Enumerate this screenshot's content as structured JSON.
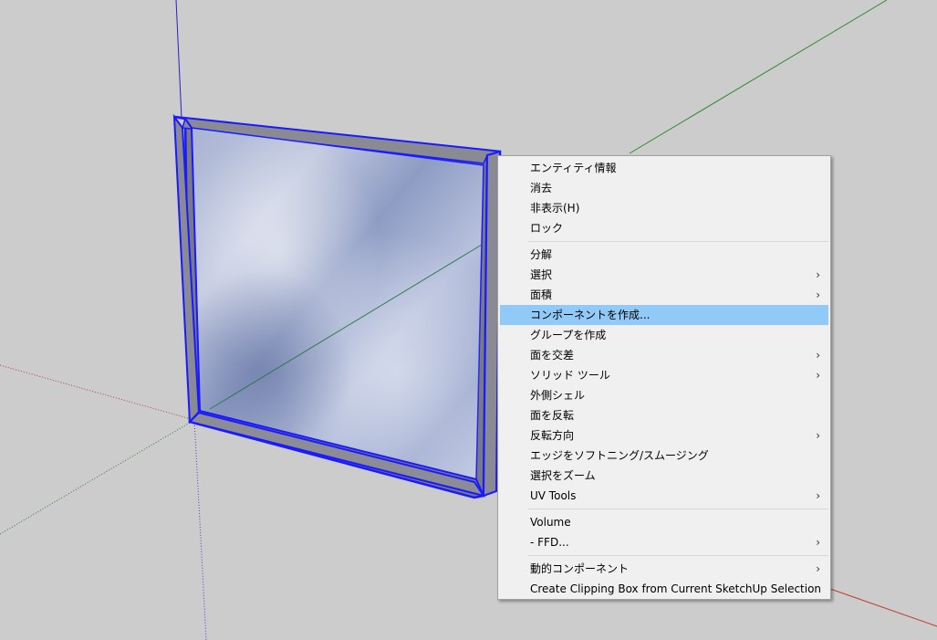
{
  "context_menu": {
    "groups": [
      [
        {
          "label": "エンティティ情報",
          "submenu": false
        },
        {
          "label": "消去",
          "submenu": false
        },
        {
          "label": "非表示(H)",
          "submenu": false
        },
        {
          "label": "ロック",
          "submenu": false
        }
      ],
      [
        {
          "label": "分解",
          "submenu": false
        },
        {
          "label": "選択",
          "submenu": true
        },
        {
          "label": "面積",
          "submenu": true
        },
        {
          "label": "コンポーネントを作成...",
          "submenu": false,
          "highlighted": true
        },
        {
          "label": "グループを作成",
          "submenu": false
        },
        {
          "label": "面を交差",
          "submenu": true
        },
        {
          "label": "ソリッド ツール",
          "submenu": true
        },
        {
          "label": "外側シェル",
          "submenu": false
        },
        {
          "label": "面を反転",
          "submenu": false
        },
        {
          "label": "反転方向",
          "submenu": true
        },
        {
          "label": "エッジをソフトニング/スムージング",
          "submenu": false
        },
        {
          "label": "選択をズーム",
          "submenu": false
        },
        {
          "label": "UV Tools",
          "submenu": true
        }
      ],
      [
        {
          "label": "Volume",
          "submenu": false
        },
        {
          "label": "- FFD...",
          "submenu": true
        }
      ],
      [
        {
          "label": "動的コンポーネント",
          "submenu": true
        },
        {
          "label": "Create Clipping Box from Current SketchUp Selection",
          "submenu": false
        }
      ]
    ],
    "submenu_arrow": "›"
  },
  "colors": {
    "background": "#cccccc",
    "selection_blue": "#1a1aff",
    "menu_highlight": "#91c9f7",
    "axis_red": "#c0392b",
    "axis_green": "#2e8b2e",
    "axis_blue": "#2222cc"
  }
}
